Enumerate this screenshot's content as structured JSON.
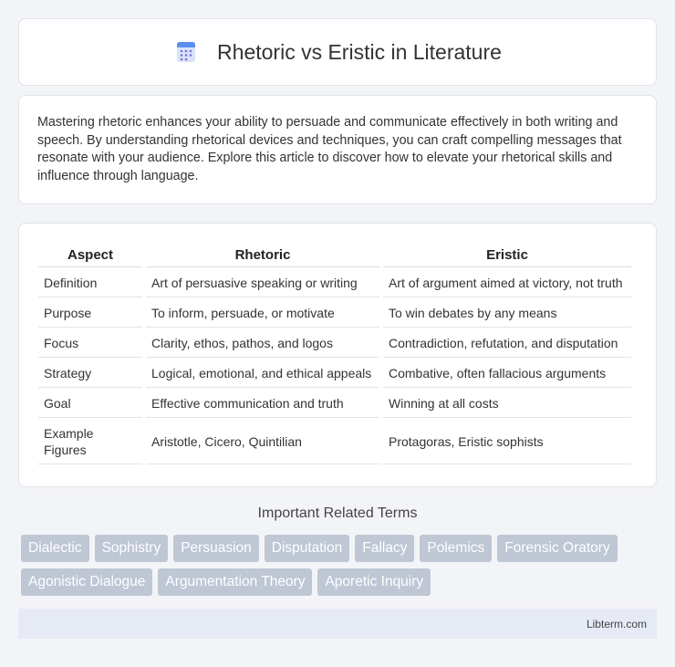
{
  "header": {
    "title": "Rhetoric vs Eristic in Literature",
    "icon": "document-icon"
  },
  "intro": {
    "text": "Mastering rhetoric enhances your ability to persuade and communicate effectively in both writing and speech. By understanding rhetorical devices and techniques, you can craft compelling messages that resonate with your audience. Explore this article to discover how to elevate your rhetorical skills and influence through language."
  },
  "table": {
    "headers": [
      "Aspect",
      "Rhetoric",
      "Eristic"
    ],
    "rows": [
      [
        "Definition",
        "Art of persuasive speaking or writing",
        "Art of argument aimed at victory, not truth"
      ],
      [
        "Purpose",
        "To inform, persuade, or motivate",
        "To win debates by any means"
      ],
      [
        "Focus",
        "Clarity, ethos, pathos, and logos",
        "Contradiction, refutation, and disputation"
      ],
      [
        "Strategy",
        "Logical, emotional, and ethical appeals",
        "Combative, often fallacious arguments"
      ],
      [
        "Goal",
        "Effective communication and truth",
        "Winning at all costs"
      ],
      [
        "Example Figures",
        "Aristotle, Cicero, Quintilian",
        "Protagoras, Eristic sophists"
      ]
    ]
  },
  "related": {
    "title": "Important Related Terms",
    "tags": [
      "Dialectic",
      "Sophistry",
      "Persuasion",
      "Disputation",
      "Fallacy",
      "Polemics",
      "Forensic Oratory",
      "Agonistic Dialogue",
      "Argumentation Theory",
      "Aporetic Inquiry"
    ]
  },
  "footer": {
    "text": "Libterm.com"
  },
  "colors": {
    "tag_bg": "#bfc6d4",
    "footer_bg": "#e6eaf4",
    "icon_blue": "#5b8def"
  }
}
